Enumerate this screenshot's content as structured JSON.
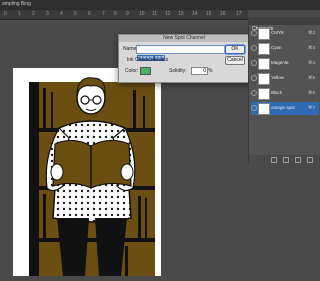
{
  "document_tab": {
    "title": "ampling Bing"
  },
  "ruler": {
    "ticks": [
      "0",
      "1",
      "2",
      "3",
      "4",
      "5",
      "6",
      "7",
      "8",
      "9",
      "10",
      "11",
      "12",
      "13",
      "14",
      "15",
      "16",
      "17"
    ]
  },
  "dialog": {
    "title": "New Spot Channel",
    "name_label": "Name:",
    "name_value": "orange spot",
    "ok_label": "OK",
    "cancel_label": "Cancel",
    "section_label": "Ink Characteristics",
    "color_label": "Color:",
    "color_value": "#4caf62",
    "solidity_label": "Solidity:",
    "solidity_value": "0",
    "solidity_unit": "%"
  },
  "channels_panel": {
    "tab_label": "Channels",
    "rows": [
      {
        "label": "CMYK",
        "key": "⌘2"
      },
      {
        "label": "Cyan",
        "key": "⌘3"
      },
      {
        "label": "Magenta",
        "key": "⌘4"
      },
      {
        "label": "Yellow",
        "key": "⌘5"
      },
      {
        "label": "Black",
        "key": "⌘6"
      },
      {
        "label": "orange spot",
        "key": "⌘7",
        "active": true
      }
    ]
  },
  "colors": {
    "accent": "#2f6bb3",
    "ink": "#6b4f12"
  }
}
